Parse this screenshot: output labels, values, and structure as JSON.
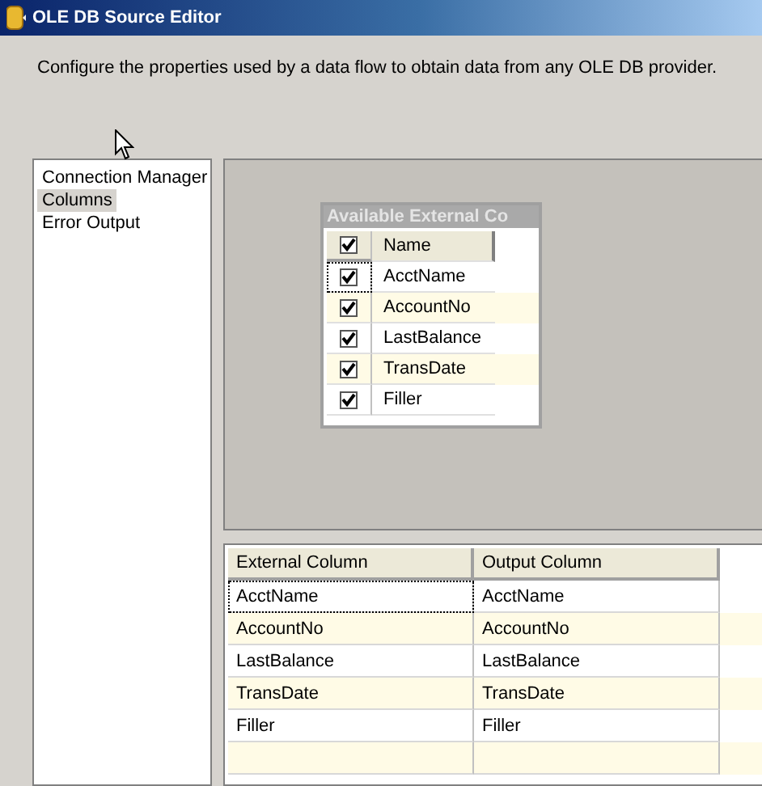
{
  "window": {
    "title": "OLE DB Source Editor"
  },
  "description": "Configure the properties used by a data flow to obtain data from any OLE DB provider.",
  "sidebar": {
    "items": [
      {
        "label": "Connection Manager",
        "selected": false
      },
      {
        "label": "Columns",
        "selected": true
      },
      {
        "label": "Error Output",
        "selected": false
      }
    ]
  },
  "available_columns": {
    "title": "Available External Co",
    "header_checked": true,
    "header": "Name",
    "rows": [
      {
        "name": "AcctName",
        "checked": true
      },
      {
        "name": "AccountNo",
        "checked": true
      },
      {
        "name": "LastBalance",
        "checked": true
      },
      {
        "name": "TransDate",
        "checked": true
      },
      {
        "name": "Filler",
        "checked": true
      }
    ]
  },
  "mapping_table": {
    "columns": [
      "External Column",
      "Output Column"
    ],
    "rows": [
      [
        "AcctName",
        "AcctName"
      ],
      [
        "AccountNo",
        "AccountNo"
      ],
      [
        "LastBalance",
        "LastBalance"
      ],
      [
        "TransDate",
        "TransDate"
      ],
      [
        "Filler",
        "Filler"
      ]
    ]
  }
}
